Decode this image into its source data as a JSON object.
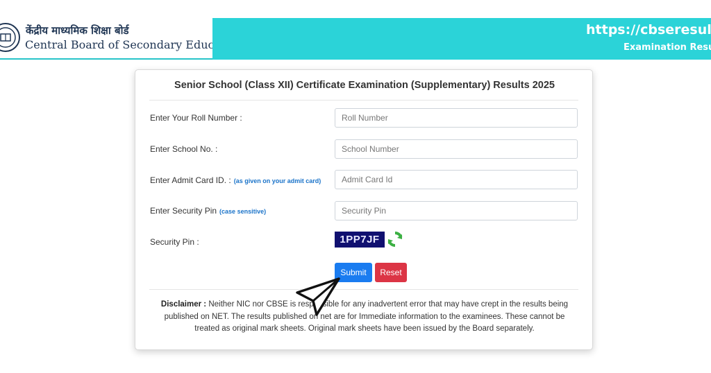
{
  "header": {
    "hindi_title": "केंद्रीय माध्यमिक शिक्षा बोर्ड",
    "english_title": "Central Board of Secondary Education",
    "url": "https://cbseresults.nic.in",
    "subtitle": "Examination Results"
  },
  "form": {
    "title": "Senior School (Class XII) Certificate Examination (Supplementary) Results 2025",
    "roll": {
      "label": "Enter Your Roll Number :",
      "placeholder": "Roll Number"
    },
    "school": {
      "label": "Enter School No. :",
      "placeholder": "School Number"
    },
    "admit": {
      "label": "Enter Admit Card ID. :",
      "note": "(as given on your admit card)",
      "placeholder": "Admit Card Id"
    },
    "pin": {
      "label": "Enter Security Pin",
      "note": "(case sensitive)",
      "placeholder": "Security Pin"
    },
    "captcha": {
      "label": "Security Pin :",
      "code": "1PP7JF"
    },
    "submit_label": "Submit",
    "reset_label": "Reset"
  },
  "disclaimer": {
    "heading": "Disclaimer :",
    "text": "Neither NIC nor CBSE is responsible for any inadvertent error that may have crept in the results being published on NET. The results published on net are for Immediate information to the examinees. These cannot be treated as original mark sheets. Original mark sheets have been issued by the Board separately."
  },
  "colors": {
    "header_band": "#2bd3d8",
    "submit": "#1a7cf0",
    "reset": "#dc3545",
    "captcha_bg": "#101070"
  },
  "icons": [
    "cbse-logo-icon",
    "refresh-icon",
    "cursor-arrow-icon"
  ]
}
